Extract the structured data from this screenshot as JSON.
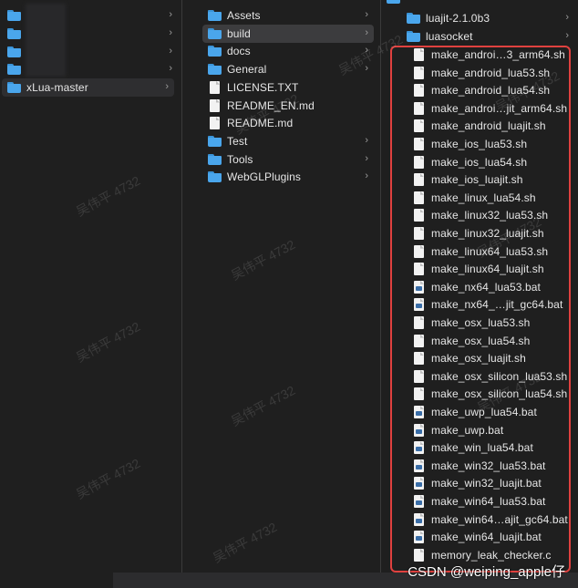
{
  "col1": {
    "items": [
      {
        "label": ""
      },
      {
        "label": ""
      },
      {
        "label": ""
      },
      {
        "label": ""
      },
      {
        "label": "xLua-master"
      }
    ]
  },
  "col2": {
    "items": [
      {
        "label": "Assets",
        "type": "folder",
        "chevron": true
      },
      {
        "label": "build",
        "type": "folder",
        "chevron": true
      },
      {
        "label": "docs",
        "type": "folder",
        "chevron": true
      },
      {
        "label": "General",
        "type": "folder",
        "chevron": true
      },
      {
        "label": "LICENSE.TXT",
        "type": "doc",
        "chevron": false
      },
      {
        "label": "README_EN.md",
        "type": "doc",
        "chevron": false
      },
      {
        "label": "README.md",
        "type": "doc",
        "chevron": false
      },
      {
        "label": "Test",
        "type": "folder",
        "chevron": true
      },
      {
        "label": "Tools",
        "type": "folder",
        "chevron": true
      },
      {
        "label": "WebGLPlugins",
        "type": "folder",
        "chevron": true
      }
    ]
  },
  "col3": {
    "top_items": [
      {
        "label": "luajit-2.1.0b3",
        "type": "folder"
      },
      {
        "label": "luasocket",
        "type": "folder"
      }
    ],
    "files": [
      {
        "label": "make_androi…3_arm64.sh",
        "type": "doc"
      },
      {
        "label": "make_android_lua53.sh",
        "type": "doc"
      },
      {
        "label": "make_android_lua54.sh",
        "type": "doc"
      },
      {
        "label": "make_androi…jit_arm64.sh",
        "type": "doc"
      },
      {
        "label": "make_android_luajit.sh",
        "type": "doc"
      },
      {
        "label": "make_ios_lua53.sh",
        "type": "doc"
      },
      {
        "label": "make_ios_lua54.sh",
        "type": "doc"
      },
      {
        "label": "make_ios_luajit.sh",
        "type": "doc"
      },
      {
        "label": "make_linux_lua54.sh",
        "type": "doc"
      },
      {
        "label": "make_linux32_lua53.sh",
        "type": "doc"
      },
      {
        "label": "make_linux32_luajit.sh",
        "type": "doc"
      },
      {
        "label": "make_linux64_lua53.sh",
        "type": "doc"
      },
      {
        "label": "make_linux64_luajit.sh",
        "type": "doc"
      },
      {
        "label": "make_nx64_lua53.bat",
        "type": "bat"
      },
      {
        "label": "make_nx64_…jit_gc64.bat",
        "type": "bat"
      },
      {
        "label": "make_osx_lua53.sh",
        "type": "doc"
      },
      {
        "label": "make_osx_lua54.sh",
        "type": "doc"
      },
      {
        "label": "make_osx_luajit.sh",
        "type": "doc"
      },
      {
        "label": "make_osx_silicon_lua53.sh",
        "type": "doc"
      },
      {
        "label": "make_osx_silicon_lua54.sh",
        "type": "doc"
      },
      {
        "label": "make_uwp_lua54.bat",
        "type": "bat"
      },
      {
        "label": "make_uwp.bat",
        "type": "bat"
      },
      {
        "label": "make_win_lua54.bat",
        "type": "bat"
      },
      {
        "label": "make_win32_lua53.bat",
        "type": "bat"
      },
      {
        "label": "make_win32_luajit.bat",
        "type": "bat"
      },
      {
        "label": "make_win64_lua53.bat",
        "type": "bat"
      },
      {
        "label": "make_win64…ajit_gc64.bat",
        "type": "bat"
      },
      {
        "label": "make_win64_luajit.bat",
        "type": "bat"
      },
      {
        "label": "memory_leak_checker.c",
        "type": "doc"
      }
    ]
  },
  "watermark_text": "吴伟平 4732",
  "credit": "CSDN @weiping_apple仔",
  "colors": {
    "highlight": "#e0413f",
    "folder": "#4aa6ec"
  }
}
